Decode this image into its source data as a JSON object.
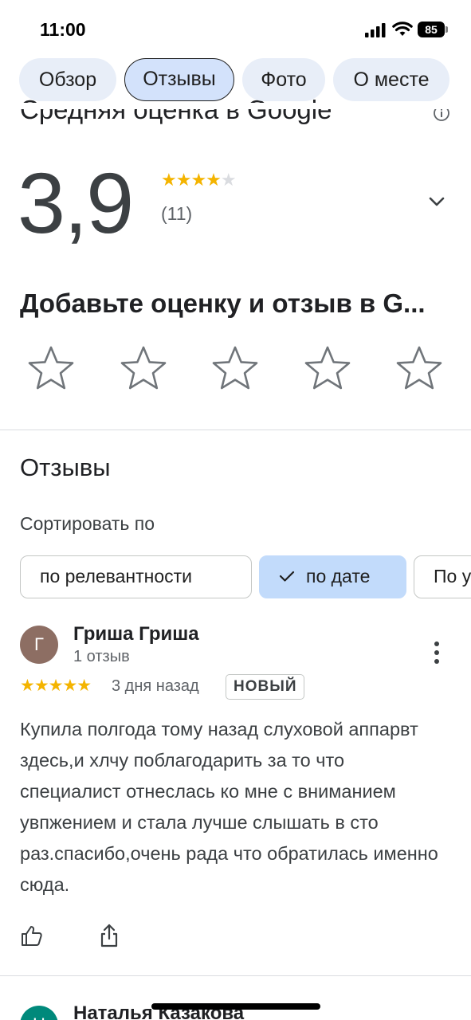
{
  "status_bar": {
    "time": "11:00",
    "battery": "85"
  },
  "tabs": [
    {
      "label": "Обзор",
      "active": false
    },
    {
      "label": "Отзывы",
      "active": true
    },
    {
      "label": "Фото",
      "active": false
    },
    {
      "label": "О месте",
      "active": false
    }
  ],
  "rating": {
    "title": "Средняя оценка в Google",
    "value": "3,9",
    "stars": 3.9,
    "count": "(11)"
  },
  "add_review": {
    "title": "Добавьте оценку и отзыв в G..."
  },
  "reviews": {
    "title": "Отзывы",
    "sort_label": "Сортировать по",
    "sort_options": [
      "по релевантности",
      "по дате",
      "По у"
    ],
    "selected_sort": "по дате"
  },
  "review_1": {
    "avatar_letter": "Г",
    "name": "Гриша Гриша",
    "meta": "1 отзыв",
    "stars": 5,
    "time": "3 дня назад",
    "badge": "НОВЫЙ",
    "text": "Купила полгода тому назад слуховой аппарвт здесь,и хлчу поблагодарить за то что специалист отнеслась ко мне с вниманием увпжением и стала лучше слышать в сто раз.спасибо,очень рада что обратилась именно сюда."
  },
  "review_2": {
    "avatar_letter": "Н",
    "name": "Наталья Казакова"
  },
  "colors": {
    "star": "#f4b400",
    "selected_chip": "#c2dbfb",
    "tab_bg": "#e8eef8"
  }
}
